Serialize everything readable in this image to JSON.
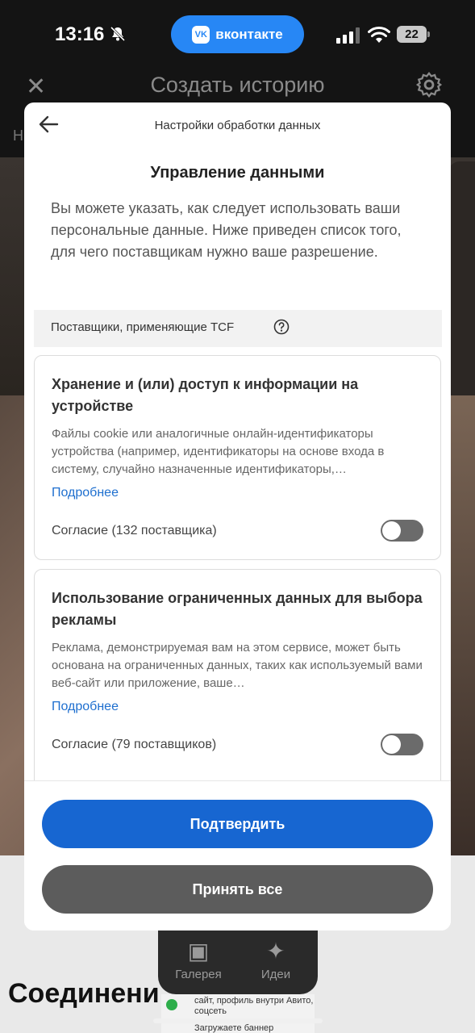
{
  "status_bar": {
    "time": "13:16",
    "app_pill": "вконтакте",
    "vk_logo": "VK",
    "battery": "22"
  },
  "background": {
    "title": "Создать историю",
    "left_letter": "Н",
    "bottom_heading": "Соединени",
    "tabs": [
      {
        "label": "Галерея",
        "icon": "gallery-icon"
      },
      {
        "label": "Идеи",
        "icon": "ideas-icon"
      }
    ],
    "snippet_line1": "сайт, профиль внутри Авито, соцсеть",
    "snippet_line2": "Загружаете баннер"
  },
  "modal": {
    "header_title": "Настройки обработки данных",
    "section_title": "Управление данными",
    "intro": "Вы можете указать, как следует использовать ваши персональные данные. Ниже приведен список того, для чего поставщикам нужно ваше разрешение.",
    "tcf_label": "Поставщики, применяющие TCF",
    "cards": [
      {
        "title": "Хранение и (или) доступ к информации на устройстве",
        "description": "Файлы cookie или аналогичные онлайн-идентификаторы устройства (например, идентификаторы на основе входа в систему, случайно назначенные идентификаторы,…",
        "link": "Подробнее",
        "consent": "Согласие (132 поставщика)",
        "enabled": false
      },
      {
        "title": "Использование ограниченных данных для выбора рекламы",
        "description": "Реклама, демонстрируемая вам на этом сервисе, может быть основана на ограниченных данных, таких как используемый вами веб-сайт или приложение, ваше…",
        "link": "Подробнее",
        "consent": "Согласие (79 поставщиков)",
        "enabled": false
      }
    ],
    "confirm_button": "Подтвердить",
    "accept_all_button": "Принять все"
  },
  "colors": {
    "primary": "#1766d1",
    "secondary_button": "#5c5c5c",
    "link": "#1e6fcf",
    "vk_blue": "#2787f5"
  }
}
